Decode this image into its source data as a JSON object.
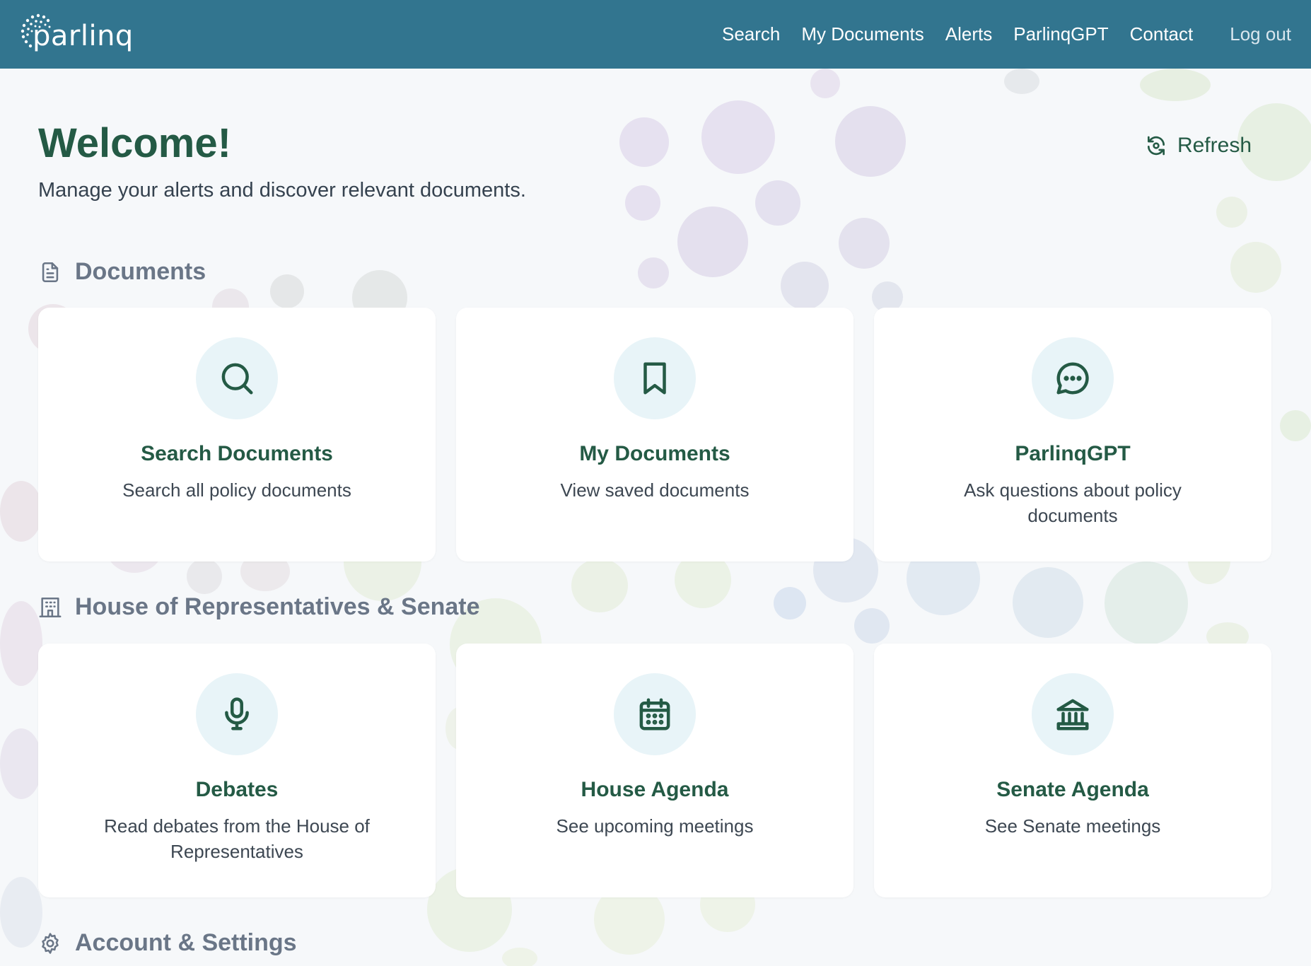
{
  "header": {
    "logo_text": "parlinq",
    "nav": [
      "Search",
      "My Documents",
      "Alerts",
      "ParlinqGPT",
      "Contact"
    ],
    "logout_label": "Log out"
  },
  "main": {
    "title": "Welcome!",
    "subtitle": "Manage your alerts and discover relevant documents.",
    "refresh_label": "Refresh"
  },
  "sections": [
    {
      "title": "Documents",
      "icon": "document-icon",
      "cards": [
        {
          "title": "Search Documents",
          "desc": "Search all policy documents",
          "icon": "search-icon"
        },
        {
          "title": "My Documents",
          "desc": "View saved documents",
          "icon": "bookmark-icon"
        },
        {
          "title": "ParlinqGPT",
          "desc": "Ask questions about policy documents",
          "icon": "chat-bubble-icon"
        }
      ]
    },
    {
      "title": "House of Representatives & Senate",
      "icon": "building-icon",
      "cards": [
        {
          "title": "Debates",
          "desc": "Read debates from the House of Representatives",
          "icon": "microphone-icon"
        },
        {
          "title": "House Agenda",
          "desc": "See upcoming meetings",
          "icon": "calendar-icon"
        },
        {
          "title": "Senate Agenda",
          "desc": "See Senate meetings",
          "icon": "government-building-icon"
        }
      ]
    },
    {
      "title": "Account & Settings",
      "icon": "gear-icon",
      "cards": []
    }
  ],
  "colors": {
    "header_bg": "#32758f",
    "accent_green": "#245a45",
    "icon_circle_bg": "#e8f4f8"
  }
}
